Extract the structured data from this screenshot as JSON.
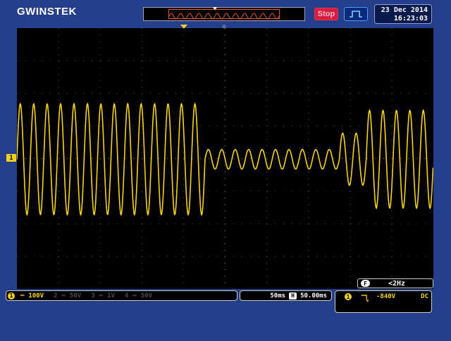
{
  "header": {
    "brand": "GWINSTEK",
    "run_status": "Stop",
    "date": "23 Dec 2014",
    "time": "16:23:03"
  },
  "channels": {
    "ch1_marker": "1",
    "ch1": {
      "number": "1",
      "coupling_symbol": "═",
      "scale": "100V"
    },
    "ch2": {
      "number": "2",
      "coupling_symbol": "═",
      "scale": "50V"
    },
    "ch3": {
      "number": "3",
      "coupling_symbol": "═",
      "scale": "1V"
    },
    "ch4": {
      "number": "4",
      "coupling_symbol": "═",
      "scale": "50V"
    }
  },
  "timebase": {
    "scale": "50ms",
    "h_label": "H",
    "position": "50.00ms"
  },
  "trigger": {
    "source": "1",
    "slope_symbol": "⺄",
    "level": "-840V",
    "coupling": "DC"
  },
  "frequency": {
    "label": "F",
    "value": "<2Hz"
  },
  "colors": {
    "trace": "#f4d21a",
    "frame": "#243e8a",
    "stop": "#d71c3c"
  },
  "waveform": {
    "segments": [
      {
        "cycles": 14,
        "amplitude_divs": 1.7
      },
      {
        "cycles": 10,
        "amplitude_divs": 0.3
      },
      {
        "cycles": 2,
        "amplitude_divs": 0.8
      },
      {
        "cycles": 5,
        "amplitude_divs": 1.5
      }
    ]
  }
}
